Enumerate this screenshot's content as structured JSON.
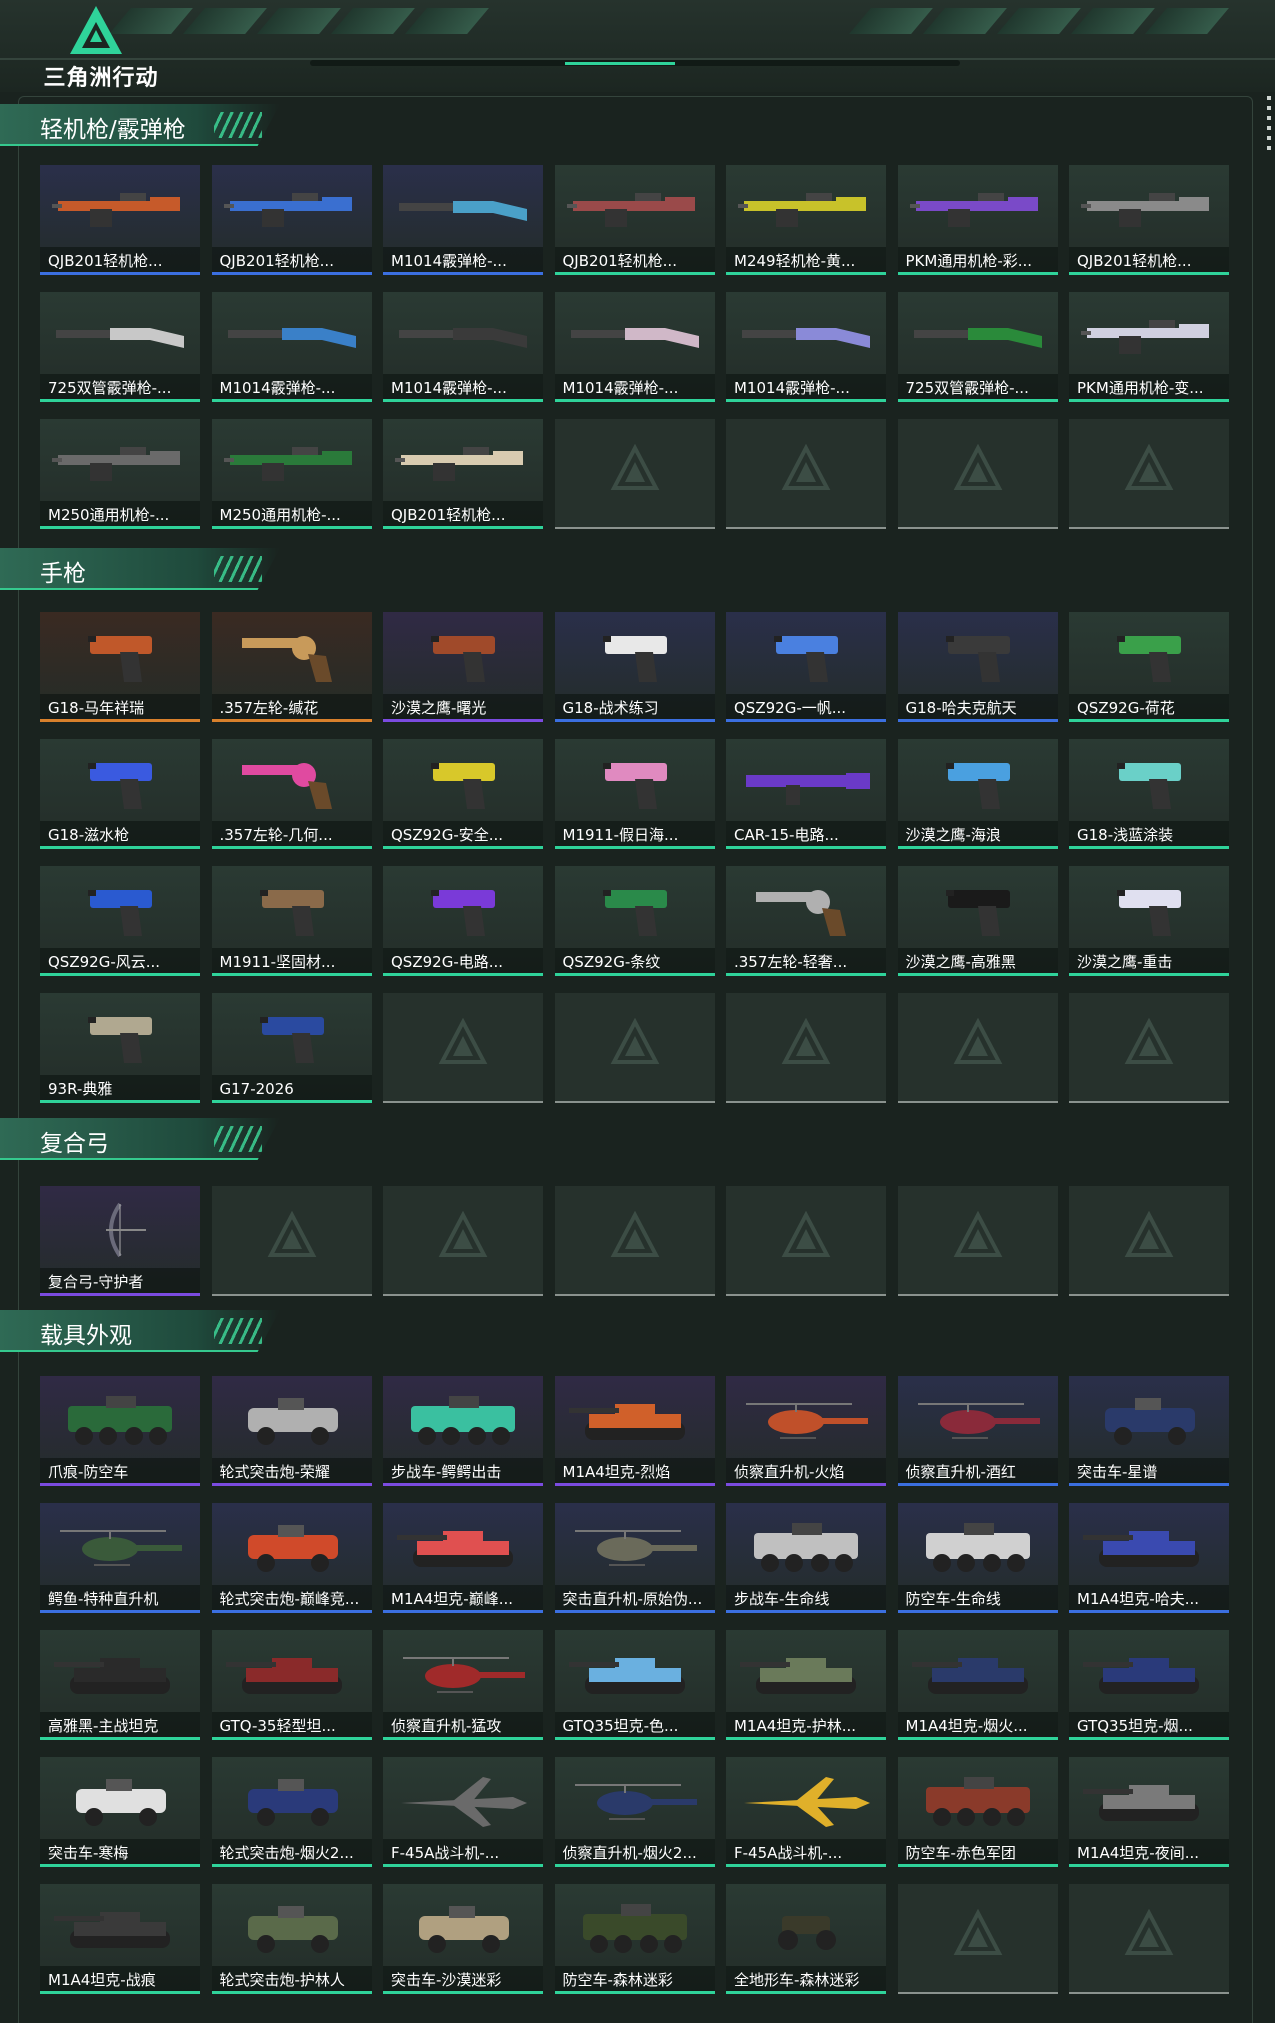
{
  "header": {
    "logo_text": "三角洲行动",
    "logo_icon": "delta-triangle-logo-icon"
  },
  "colors": {
    "green": "#2fd39a",
    "blue": "#3b6fe0",
    "purple": "#7b4be0",
    "orange": "#d8802c",
    "gray": "#8a928e"
  },
  "sections": [
    {
      "title": "轻机枪/霰弹枪",
      "items": [
        {
          "label": "QJB201轻机枪...",
          "rarity": "blue",
          "bg": "#2a2f4a",
          "kind": "mg",
          "tint": "#c65a2a"
        },
        {
          "label": "QJB201轻机枪...",
          "rarity": "blue",
          "bg": "#2a2f4a",
          "kind": "mg",
          "tint": "#3a6fd0"
        },
        {
          "label": "M1014霰弹枪-...",
          "rarity": "blue",
          "bg": "#2a2f4a",
          "kind": "shotgun",
          "tint": "#4aa0c8"
        },
        {
          "label": "QJB201轻机枪...",
          "rarity": "green",
          "bg": "#2a3a33",
          "kind": "mg",
          "tint": "#9a4a4a"
        },
        {
          "label": "M249轻机枪-黄...",
          "rarity": "green",
          "bg": "#2a3a33",
          "kind": "mg",
          "tint": "#c8c22a"
        },
        {
          "label": "PKM通用机枪-彩...",
          "rarity": "green",
          "bg": "#2a3a33",
          "kind": "mg",
          "tint": "#7a4ac8"
        },
        {
          "label": "QJB201轻机枪...",
          "rarity": "green",
          "bg": "#2a3a33",
          "kind": "mg",
          "tint": "#8a8a8a"
        },
        {
          "label": "725双管霰弹枪-...",
          "rarity": "green",
          "bg": "#2a3a33",
          "kind": "shotgun",
          "tint": "#c8c8c8"
        },
        {
          "label": "M1014霰弹枪-...",
          "rarity": "green",
          "bg": "#2a3a33",
          "kind": "shotgun",
          "tint": "#3a80c8"
        },
        {
          "label": "M1014霰弹枪-...",
          "rarity": "green",
          "bg": "#2a3a33",
          "kind": "shotgun",
          "tint": "#3a3a3a"
        },
        {
          "label": "M1014霰弹枪-...",
          "rarity": "green",
          "bg": "#2a3a33",
          "kind": "shotgun",
          "tint": "#d0b8c8"
        },
        {
          "label": "M1014霰弹枪-...",
          "rarity": "green",
          "bg": "#2a3a33",
          "kind": "shotgun",
          "tint": "#8a8ad8"
        },
        {
          "label": "725双管霰弹枪-...",
          "rarity": "green",
          "bg": "#2a3a33",
          "kind": "shotgun",
          "tint": "#2a8a3a"
        },
        {
          "label": "PKM通用机枪-变...",
          "rarity": "green",
          "bg": "#2a3a33",
          "kind": "mg",
          "tint": "#d0d0e0"
        },
        {
          "label": "M250通用机枪-...",
          "rarity": "green",
          "bg": "#2a3a33",
          "kind": "mg",
          "tint": "#6a6a6a"
        },
        {
          "label": "M250通用机枪-...",
          "rarity": "green",
          "bg": "#2a3a33",
          "kind": "mg",
          "tint": "#2a7a3a"
        },
        {
          "label": "QJB201轻机枪...",
          "rarity": "green",
          "bg": "#2a3a33",
          "kind": "mg",
          "tint": "#d8cbb0"
        },
        {
          "empty": true
        },
        {
          "empty": true
        },
        {
          "empty": true
        },
        {
          "empty": true
        }
      ]
    },
    {
      "title": "手枪",
      "items": [
        {
          "label": "G18-马年祥瑞",
          "rarity": "orange",
          "bg": "#3a2a22",
          "kind": "pistol",
          "tint": "#c0582a"
        },
        {
          "label": ".357左轮-缄花",
          "rarity": "orange",
          "bg": "#3a2a22",
          "kind": "revolver",
          "tint": "#c89a5a"
        },
        {
          "label": "沙漠之鹰-曙光",
          "rarity": "purple",
          "bg": "#302a45",
          "kind": "pistol",
          "tint": "#a04a2a"
        },
        {
          "label": "G18-战术练习",
          "rarity": "blue",
          "bg": "#2a2f4a",
          "kind": "pistol",
          "tint": "#e8e8e8"
        },
        {
          "label": "QSZ92G-一帆...",
          "rarity": "blue",
          "bg": "#2a2f4a",
          "kind": "pistol",
          "tint": "#4a80e0"
        },
        {
          "label": "G18-哈夫克航天",
          "rarity": "blue",
          "bg": "#2a2f4a",
          "kind": "pistol",
          "tint": "#3a3a3a"
        },
        {
          "label": "QSZ92G-荷花",
          "rarity": "green",
          "bg": "#2a3a33",
          "kind": "pistol",
          "tint": "#3aa04a"
        },
        {
          "label": "G18-滋水枪",
          "rarity": "green",
          "bg": "#2a3a33",
          "kind": "pistol",
          "tint": "#3a5ae0"
        },
        {
          "label": ".357左轮-几何...",
          "rarity": "green",
          "bg": "#2a3a33",
          "kind": "revolver",
          "tint": "#e04aa0"
        },
        {
          "label": "QSZ92G-安全...",
          "rarity": "green",
          "bg": "#2a3a33",
          "kind": "pistol",
          "tint": "#d8c82a"
        },
        {
          "label": "M1911-假日海...",
          "rarity": "green",
          "bg": "#2a3a33",
          "kind": "pistol",
          "tint": "#e08ac0"
        },
        {
          "label": "CAR-15-电路...",
          "rarity": "green",
          "bg": "#2a3a33",
          "kind": "rifle",
          "tint": "#6a3ac8"
        },
        {
          "label": "沙漠之鹰-海浪",
          "rarity": "green",
          "bg": "#2a3a33",
          "kind": "pistol",
          "tint": "#4aa0e0"
        },
        {
          "label": "G18-浅蓝涂装",
          "rarity": "green",
          "bg": "#2a3a33",
          "kind": "pistol",
          "tint": "#6ad0c8"
        },
        {
          "label": "QSZ92G-风云...",
          "rarity": "green",
          "bg": "#2a3a33",
          "kind": "pistol",
          "tint": "#2a5ad0"
        },
        {
          "label": "M1911-坚固材...",
          "rarity": "green",
          "bg": "#2a3a33",
          "kind": "pistol",
          "tint": "#8a6a4a"
        },
        {
          "label": "QSZ92G-电路...",
          "rarity": "green",
          "bg": "#2a3a33",
          "kind": "pistol",
          "tint": "#7a3ad8"
        },
        {
          "label": "QSZ92G-条纹",
          "rarity": "green",
          "bg": "#2a3a33",
          "kind": "pistol",
          "tint": "#2a8a4a"
        },
        {
          "label": ".357左轮-轻奢...",
          "rarity": "green",
          "bg": "#2a3a33",
          "kind": "revolver",
          "tint": "#b0b0b0"
        },
        {
          "label": "沙漠之鹰-高雅黑",
          "rarity": "green",
          "bg": "#2a3a33",
          "kind": "pistol",
          "tint": "#1a1a1a"
        },
        {
          "label": "沙漠之鹰-重击",
          "rarity": "green",
          "bg": "#2a3a33",
          "kind": "pistol",
          "tint": "#e0e0f0"
        },
        {
          "label": "93R-典雅",
          "rarity": "green",
          "bg": "#2a3a33",
          "kind": "pistol",
          "tint": "#b0a890"
        },
        {
          "label": "G17-2026",
          "rarity": "green",
          "bg": "#2a3a33",
          "kind": "pistol",
          "tint": "#2a4aa0"
        },
        {
          "empty": true
        },
        {
          "empty": true
        },
        {
          "empty": true
        },
        {
          "empty": true
        },
        {
          "empty": true
        }
      ]
    },
    {
      "title": "复合弓",
      "items": [
        {
          "label": "复合弓-守护者",
          "rarity": "purple",
          "bg": "#302a45",
          "kind": "bow",
          "tint": "#6a6a7a"
        },
        {
          "empty": true
        },
        {
          "empty": true
        },
        {
          "empty": true
        },
        {
          "empty": true
        },
        {
          "empty": true
        },
        {
          "empty": true
        }
      ]
    },
    {
      "title": "载具外观",
      "items": [
        {
          "label": "爪痕-防空车",
          "rarity": "purple",
          "bg": "#302a45",
          "kind": "apc",
          "tint": "#2a6a3a"
        },
        {
          "label": "轮式突击炮-荣耀",
          "rarity": "purple",
          "bg": "#302a45",
          "kind": "car",
          "tint": "#b0b0b0"
        },
        {
          "label": "步战车-鳄鳄出击",
          "rarity": "purple",
          "bg": "#302a45",
          "kind": "apc",
          "tint": "#3ac0a0"
        },
        {
          "label": "M1A4坦克-烈焰",
          "rarity": "purple",
          "bg": "#302a45",
          "kind": "tank",
          "tint": "#d0602a"
        },
        {
          "label": "侦察直升机-火焰",
          "rarity": "purple",
          "bg": "#302a45",
          "kind": "heli",
          "tint": "#c0502a"
        },
        {
          "label": "侦察直升机-酒红",
          "rarity": "blue",
          "bg": "#2a2f4a",
          "kind": "heli",
          "tint": "#8a2a3a"
        },
        {
          "label": "突击车-星谱",
          "rarity": "blue",
          "bg": "#2a2f4a",
          "kind": "car",
          "tint": "#2a3a6a"
        },
        {
          "label": "鳄鱼-特种直升机",
          "rarity": "blue",
          "bg": "#2a2f4a",
          "kind": "heli",
          "tint": "#3a5a3a"
        },
        {
          "label": "轮式突击炮-巅峰竞...",
          "rarity": "blue",
          "bg": "#2a2f4a",
          "kind": "car",
          "tint": "#d04a2a"
        },
        {
          "label": "M1A4坦克-巅峰...",
          "rarity": "blue",
          "bg": "#2a2f4a",
          "kind": "tank",
          "tint": "#e05050"
        },
        {
          "label": "突击直升机-原始伪...",
          "rarity": "blue",
          "bg": "#2a2f4a",
          "kind": "heli",
          "tint": "#6a6a5a"
        },
        {
          "label": "步战车-生命线",
          "rarity": "blue",
          "bg": "#2a2f4a",
          "kind": "apc",
          "tint": "#c0c0c0"
        },
        {
          "label": "防空车-生命线",
          "rarity": "blue",
          "bg": "#2a2f4a",
          "kind": "apc",
          "tint": "#d0d0d0"
        },
        {
          "label": "M1A4坦克-哈夫...",
          "rarity": "blue",
          "bg": "#2a2f4a",
          "kind": "tank",
          "tint": "#3a4ab0"
        },
        {
          "label": "高雅黑-主战坦克",
          "rarity": "green",
          "bg": "#2a3a33",
          "kind": "tank",
          "tint": "#2a2a2a"
        },
        {
          "label": "GTQ-35轻型坦...",
          "rarity": "green",
          "bg": "#2a3a33",
          "kind": "tank",
          "tint": "#8a2a2a"
        },
        {
          "label": "侦察直升机-猛攻",
          "rarity": "green",
          "bg": "#2a3a33",
          "kind": "heli",
          "tint": "#a02a2a"
        },
        {
          "label": "GTQ35坦克-色...",
          "rarity": "green",
          "bg": "#2a3a33",
          "kind": "tank",
          "tint": "#6ab0e0"
        },
        {
          "label": "M1A4坦克-护林...",
          "rarity": "green",
          "bg": "#2a3a33",
          "kind": "tank",
          "tint": "#6a7a5a"
        },
        {
          "label": "M1A4坦克-烟火...",
          "rarity": "green",
          "bg": "#2a3a33",
          "kind": "tank",
          "tint": "#2a3a6a"
        },
        {
          "label": "GTQ35坦克-烟...",
          "rarity": "green",
          "bg": "#2a3a33",
          "kind": "tank",
          "tint": "#2a3a7a"
        },
        {
          "label": "突击车-寒梅",
          "rarity": "green",
          "bg": "#2a3a33",
          "kind": "car",
          "tint": "#e0e0e0"
        },
        {
          "label": "轮式突击炮-烟火2...",
          "rarity": "green",
          "bg": "#2a3a33",
          "kind": "car",
          "tint": "#2a3a7a"
        },
        {
          "label": "F-45A战斗机-...",
          "rarity": "green",
          "bg": "#2a3a33",
          "kind": "jet",
          "tint": "#6a6a6a"
        },
        {
          "label": "侦察直升机-烟火2...",
          "rarity": "green",
          "bg": "#2a3a33",
          "kind": "heli",
          "tint": "#2a3a6a"
        },
        {
          "label": "F-45A战斗机-...",
          "rarity": "green",
          "bg": "#2a3a33",
          "kind": "jet",
          "tint": "#e0b02a"
        },
        {
          "label": "防空车-赤色军团",
          "rarity": "green",
          "bg": "#2a3a33",
          "kind": "apc",
          "tint": "#8a3a2a"
        },
        {
          "label": "M1A4坦克-夜间...",
          "rarity": "green",
          "bg": "#2a3a33",
          "kind": "tank",
          "tint": "#7a7a7a"
        },
        {
          "label": "M1A4坦克-战痕",
          "rarity": "green",
          "bg": "#2a3a33",
          "kind": "tank",
          "tint": "#3a3a3a"
        },
        {
          "label": "轮式突击炮-护林人",
          "rarity": "green",
          "bg": "#2a3a33",
          "kind": "car",
          "tint": "#5a6a4a"
        },
        {
          "label": "突击车-沙漠迷彩",
          "rarity": "green",
          "bg": "#2a3a33",
          "kind": "car",
          "tint": "#b0a080"
        },
        {
          "label": "防空车-森林迷彩",
          "rarity": "green",
          "bg": "#2a3a33",
          "kind": "apc",
          "tint": "#3a4a2a"
        },
        {
          "label": "全地形车-森林迷彩",
          "rarity": "green",
          "bg": "#2a3a33",
          "kind": "atv",
          "tint": "#3a3a2a"
        },
        {
          "empty": true
        },
        {
          "empty": true
        }
      ]
    }
  ]
}
